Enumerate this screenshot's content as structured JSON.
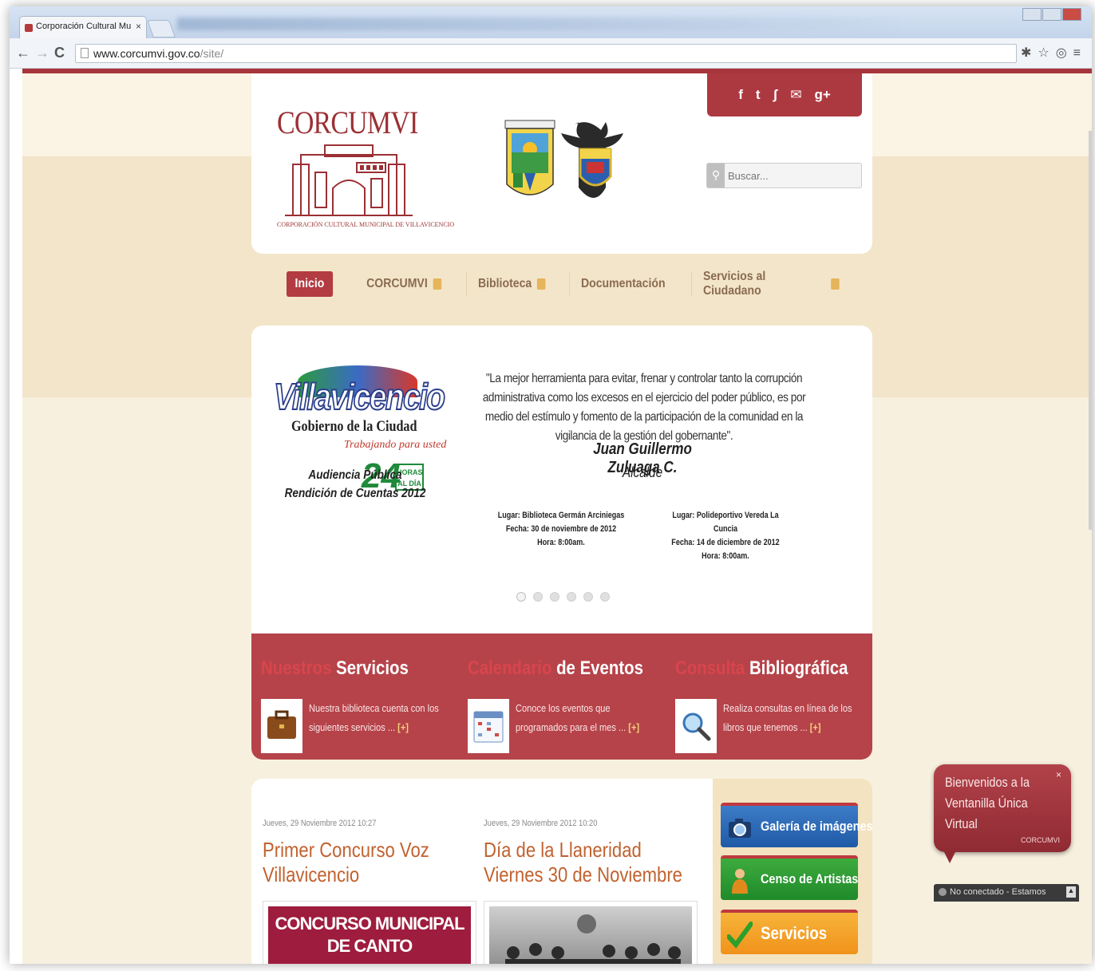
{
  "browser": {
    "tab_title": "Corporación Cultural Mu",
    "tab_close": "×",
    "url_host": "www.corcumvi.gov.co",
    "url_path": "/site/",
    "back": "←",
    "forward": "→",
    "reload": "C",
    "right_icons": "✱☆◎≡"
  },
  "header": {
    "logo_title": "CORCUMVI",
    "logo_subtitle": "CORPORACIÓN CULTURAL MUNICIPAL DE VILLAVICENCIO",
    "social": [
      "f",
      "t",
      "ʃ",
      "✉",
      "g+"
    ],
    "search_placeholder": "Buscar..."
  },
  "nav": {
    "items": [
      {
        "label": "Inicio",
        "active": true,
        "has_sub": false
      },
      {
        "label": "CORCUMVI",
        "active": false,
        "has_sub": true
      },
      {
        "label": "Biblioteca",
        "active": false,
        "has_sub": true
      },
      {
        "label": "Documentación",
        "active": false,
        "has_sub": false
      },
      {
        "label": "Servicios al Ciudadano",
        "active": false,
        "has_sub": true
      }
    ]
  },
  "slider": {
    "logo_name": "Villavicencio",
    "logo_gob": "Gobierno de la Ciudad",
    "logo_trab": "Trabajando para usted",
    "logo_24": "24",
    "logo_horas": "HORAS AL DÍA",
    "event_title_1": "Audiencia Pública",
    "event_title_2": "Rendición de Cuentas 2012",
    "quote": "\"La mejor herramienta para evitar, frenar y controlar tanto la corrupción administrativa como los excesos en el ejercicio del poder público, es por medio del estímulo y fomento de la participación de la comunidad en la vigilancia de la gestión del gobernante\".",
    "signer": "Juan Guillermo Zuluaga C.",
    "signer_role": "Alcalde",
    "event_1": {
      "lugar": "Lugar: Biblioteca Germán Arciniegas",
      "fecha": "Fecha: 30 de noviembre de 2012",
      "hora": "Hora: 8:00am."
    },
    "event_2": {
      "lugar": "Lugar: Polideportivo Vereda La Cuncia",
      "fecha": "Fecha: 14 de diciembre de 2012",
      "hora": "Hora: 8:00am."
    },
    "dots": 6,
    "active_dot": 0
  },
  "features": [
    {
      "title_a": "Nuestros",
      "title_b": "Servicios",
      "text": "Nuestra biblioteca cuenta con los siguientes servicios ... ",
      "more": "[+]",
      "icon": "briefcase-icon"
    },
    {
      "title_a": "Calendario",
      "title_b": "de Eventos",
      "text": "Conoce los eventos que programados para el mes ... ",
      "more": "[+]",
      "icon": "calendar-icon"
    },
    {
      "title_a": "Consulta",
      "title_b": "Bibliográfica",
      "text": "Realiza consultas en línea de los libros que tenemos ... ",
      "more": "[+]",
      "icon": "magnifier-icon"
    }
  ],
  "news": [
    {
      "date": "Jueves, 29 Noviembre 2012 10:27",
      "title": "Primer Concurso Voz Villavicencio",
      "image_text": "CONCURSO MUNICIPAL DE CANTO"
    },
    {
      "date": "Jueves, 29 Noviembre 2012 10:20",
      "title": "Día de la Llaneridad Viernes 30 de Noviembre"
    }
  ],
  "sidebar_buttons": [
    {
      "label": "Galería de imágenes",
      "icon": "camera-icon"
    },
    {
      "label": "Censo de Artistas",
      "icon": "artist-icon"
    },
    {
      "label": "Servicios",
      "icon": "checkmark-icon"
    }
  ],
  "chat": {
    "text": "Bienvenidos a la Ventanilla Única Virtual",
    "close": "×",
    "brand": "CORCUMVI",
    "status": "No conectado - Estamos"
  },
  "colors": {
    "brand_red": "#b33b42",
    "page_bg": "#f6eedd",
    "accent_orange": "#c1622f"
  }
}
